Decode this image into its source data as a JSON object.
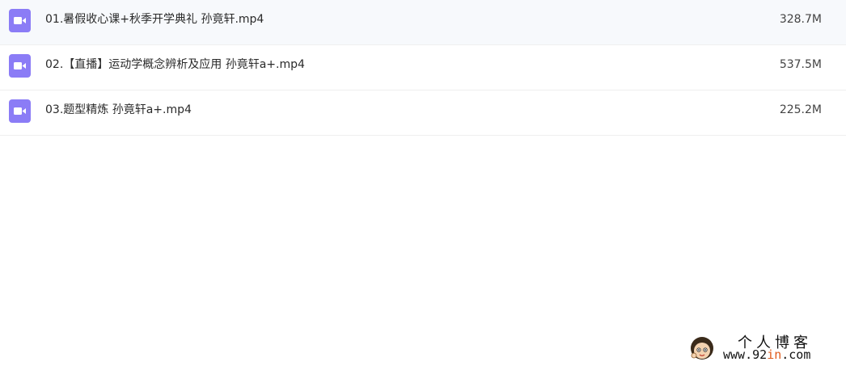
{
  "files": [
    {
      "name": "01.暑假收心课+秋季开学典礼 孙竟轩.mp4",
      "size": "328.7M",
      "icon": "video-file-icon"
    },
    {
      "name": "02.【直播】运动学概念辨析及应用 孙竟轩a+.mp4",
      "size": "537.5M",
      "icon": "video-file-icon"
    },
    {
      "name": "03.题型精炼 孙竟轩a+.mp4",
      "size": "225.2M",
      "icon": "video-file-icon"
    }
  ],
  "watermark": {
    "title": "个人博客",
    "url_prefix": "www.92",
    "url_accent": "in",
    "url_suffix": ".com"
  },
  "colors": {
    "icon_purple": "#8b7cf6",
    "row_border": "#efefef",
    "watermark_accent": "#e05a1a"
  }
}
